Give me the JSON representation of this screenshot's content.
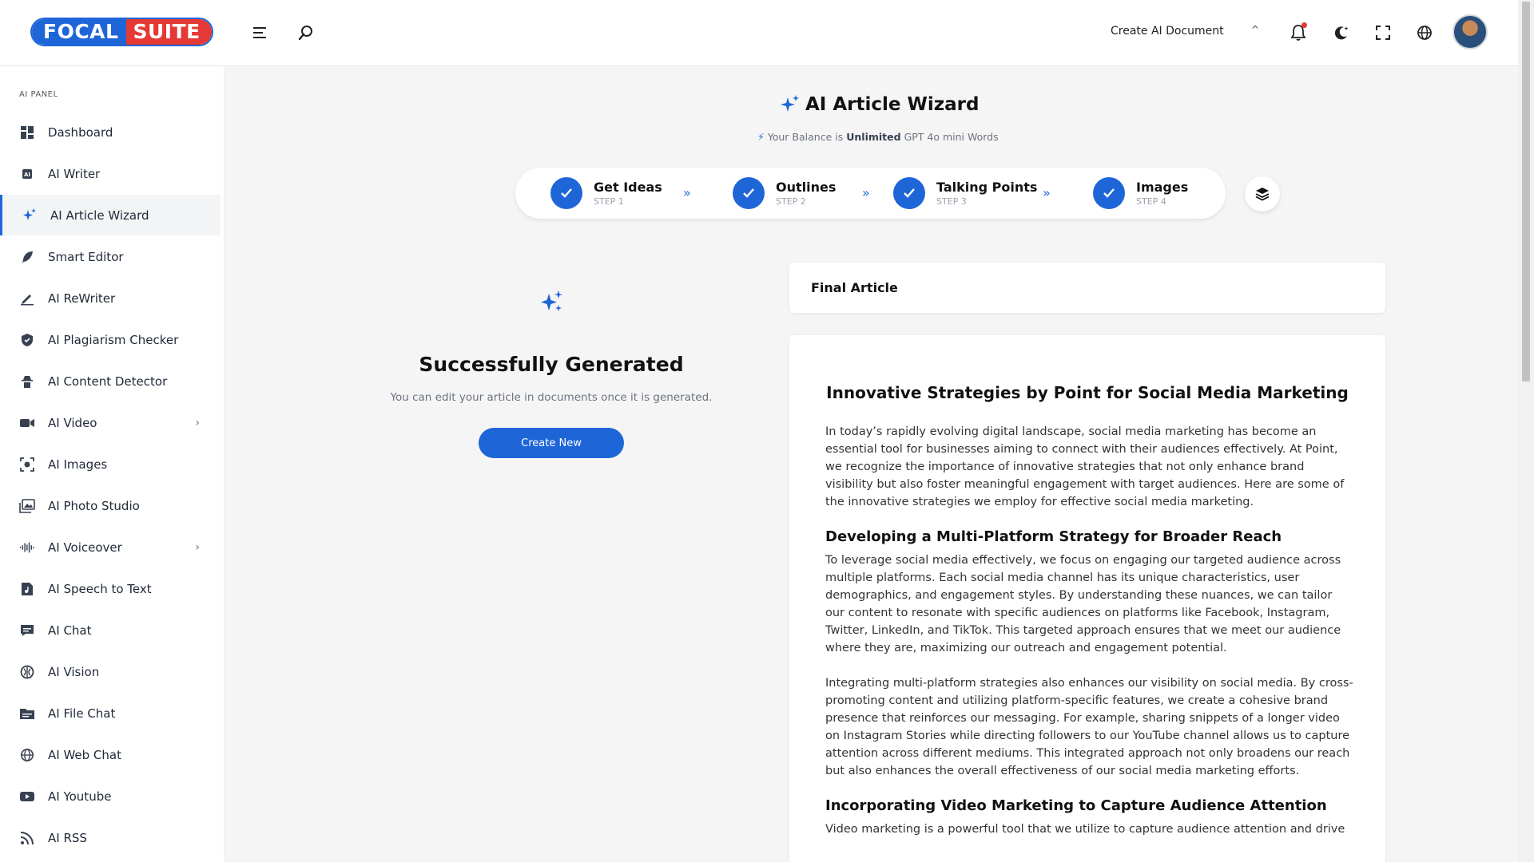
{
  "brand": {
    "part1": "FOCAL",
    "part2": "SUITE",
    "color_primary": "#1e66d8",
    "color_secondary": "#e53935"
  },
  "topbar": {
    "create_doc_label": "Create AI Document",
    "icons": [
      "menu-icon",
      "search-icon",
      "bell-icon",
      "moon-icon",
      "fullscreen-icon",
      "globe-icon"
    ]
  },
  "sidebar": {
    "section_title": "AI PANEL",
    "items": [
      {
        "label": "Dashboard",
        "icon": "dashboard-icon"
      },
      {
        "label": "AI Writer",
        "icon": "ai-chip-icon"
      },
      {
        "label": "AI Article Wizard",
        "icon": "sparkles-icon",
        "active": true
      },
      {
        "label": "Smart Editor",
        "icon": "feather-icon"
      },
      {
        "label": "AI ReWriter",
        "icon": "pen-icon"
      },
      {
        "label": "AI Plagiarism Checker",
        "icon": "shield-icon"
      },
      {
        "label": "AI Content Detector",
        "icon": "detective-icon"
      },
      {
        "label": "AI Video",
        "icon": "video-icon",
        "has_children": true
      },
      {
        "label": "AI Images",
        "icon": "image-scan-icon"
      },
      {
        "label": "AI Photo Studio",
        "icon": "photo-icon"
      },
      {
        "label": "AI Voiceover",
        "icon": "waveform-icon",
        "has_children": true
      },
      {
        "label": "AI Speech to Text",
        "icon": "music-file-icon"
      },
      {
        "label": "AI Chat",
        "icon": "chat-icon"
      },
      {
        "label": "AI Vision",
        "icon": "brain-icon"
      },
      {
        "label": "AI File Chat",
        "icon": "folder-icon"
      },
      {
        "label": "AI Web Chat",
        "icon": "globe-icon"
      },
      {
        "label": "AI Youtube",
        "icon": "youtube-icon"
      },
      {
        "label": "AI RSS",
        "icon": "rss-icon"
      }
    ]
  },
  "main": {
    "title": "AI Article Wizard",
    "balance_prefix": "Your Balance is",
    "balance_value": "Unlimited",
    "balance_suffix": "GPT 4o mini Words",
    "steps": [
      {
        "name": "Get Ideas",
        "sub": "STEP 1"
      },
      {
        "name": "Outlines",
        "sub": "STEP 2"
      },
      {
        "name": "Talking Points",
        "sub": "STEP 3"
      },
      {
        "name": "Images",
        "sub": "STEP 4"
      }
    ],
    "success_title": "Successfully Generated",
    "success_sub": "You can edit your article in documents once it is generated.",
    "create_new_label": "Create New",
    "final_article_label": "Final Article"
  },
  "article": {
    "title": "Innovative Strategies by Point for Social Media Marketing",
    "p1": "In today’s rapidly evolving digital landscape, social media marketing has become an essential tool for businesses aiming to connect with their audiences effectively. At Point, we recognize the importance of innovative strategies that not only enhance brand visibility but also foster meaningful engagement with target audiences. Here are some of the innovative strategies we employ for effective social media marketing.",
    "h2_1": "Developing a Multi-Platform Strategy for Broader Reach",
    "p2": "To leverage social media effectively, we focus on engaging our targeted audience across multiple platforms. Each social media channel has its unique characteristics, user demographics, and engagement styles. By understanding these nuances, we can tailor our content to resonate with specific audiences on platforms like Facebook, Instagram, Twitter, LinkedIn, and TikTok. This targeted approach ensures that we meet our audience where they are, maximizing our outreach and engagement potential.",
    "p3": "Integrating multi-platform strategies also enhances our visibility on social media. By cross-promoting content and utilizing platform-specific features, we create a cohesive brand presence that reinforces our messaging. For example, sharing snippets of a longer video on Instagram Stories while directing followers to our YouTube channel allows us to capture attention across different mediums. This integrated approach not only broadens our reach but also enhances the overall effectiveness of our social media marketing efforts.",
    "h2_2": "Incorporating Video Marketing to Capture Audience Attention",
    "p4": "Video marketing is a powerful tool that we utilize to capture audience attention and drive"
  }
}
